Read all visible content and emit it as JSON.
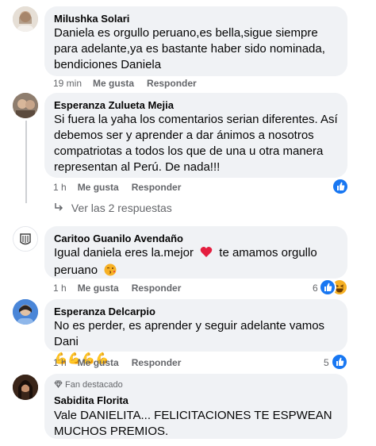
{
  "comments": [
    {
      "author": "Milushka Solari",
      "text": "Daniela es orgullo peruano,es bella,sigue siempre para adelante,ya es bastante haber sido nominada, bendiciones Daniela",
      "time": "19 min",
      "like_label": "Me gusta",
      "reply_label": "Responder"
    },
    {
      "author": "Esperanza Zulueta Mejia",
      "text": "Si fuera la yaha los comentarios serian diferentes. Así debemos ser y aprender a dar ánimos a nosotros compatriotas a todos los que de una u otra manera representan al Perú. De nada!!!",
      "time": "1 h",
      "like_label": "Me gusta",
      "reply_label": "Responder",
      "replies_label": "Ver las 2 respuestas"
    },
    {
      "author": "Caritoo Guanilo Avendaño",
      "text_before": "Igual daniela eres la.mejor",
      "text_after": "te amamos orgullo peruano",
      "time": "1 h",
      "like_label": "Me gusta",
      "reply_label": "Responder",
      "reaction_count": "6"
    },
    {
      "author": "Esperanza Delcarpio",
      "text": "No es perder, es aprender y seguir adelante vamos Dani",
      "emoji": "💪💪💪💪",
      "time": "1 h",
      "like_label": "Me gusta",
      "reply_label": "Responder",
      "reaction_count": "5"
    },
    {
      "badge": "Fan destacado",
      "author": "Sabidita Florita",
      "text": "Vale DANIELITA... FELICITACIONES TE ESPWEAN MUCHOS PREMIOS."
    }
  ],
  "colors": {
    "like": "#1877f2",
    "bubble": "#f0f2f5",
    "meta": "#65676b",
    "heart": "#e41e3f"
  }
}
